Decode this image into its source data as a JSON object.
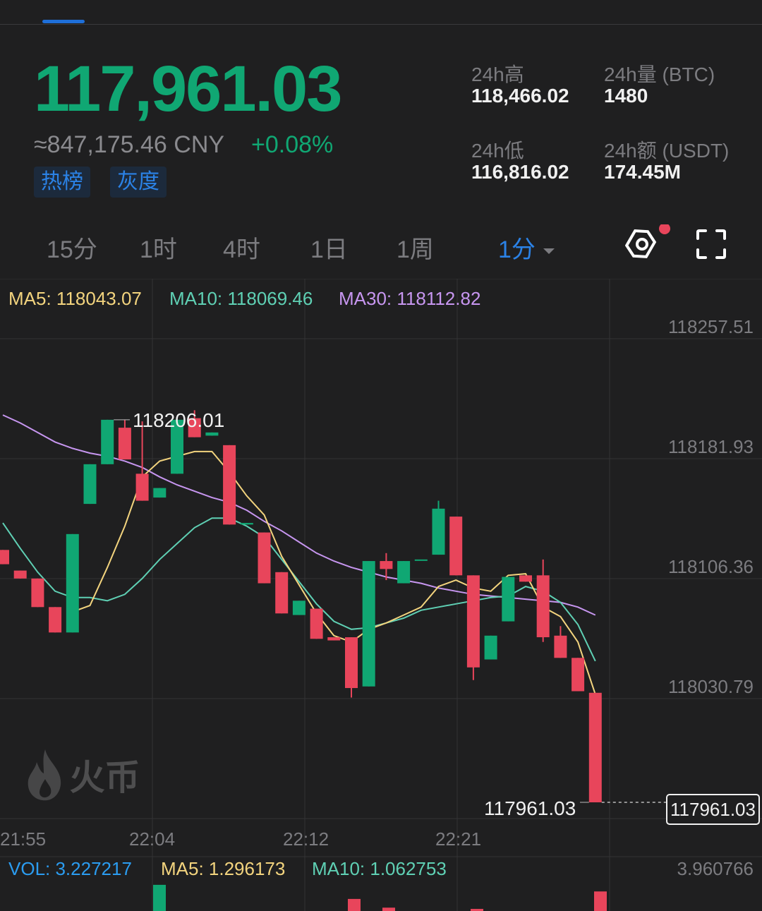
{
  "header": {
    "price": "117,961.03",
    "cny": "≈847,175.46 CNY",
    "change": "+0.08%",
    "tags": [
      "热榜",
      "灰度"
    ]
  },
  "stats": {
    "high_label": "24h高",
    "high_value": "118,466.02",
    "volume_label": "24h量 (BTC)",
    "volume_value": "1480",
    "low_label": "24h低",
    "low_value": "116,816.02",
    "turnover_label": "24h额 (USDT)",
    "turnover_value": "174.45M"
  },
  "timeframes": [
    "15分",
    "1时",
    "4时",
    "1日",
    "1周"
  ],
  "active_timeframe": "1分",
  "ma_legend": {
    "ma5": "MA5: 118043.07",
    "ma10": "MA10: 118069.46",
    "ma30": "MA30: 118112.82"
  },
  "watermark": "火币",
  "vol_legend": {
    "vol": "VOL: 3.227217",
    "ma5": "MA5: 1.296173",
    "ma10": "MA10: 1.062753",
    "max": "3.960766"
  },
  "colors": {
    "up": "#10a773",
    "down": "#e8455b",
    "ma5": "#f3d47e",
    "ma10": "#5fd0b4",
    "ma30": "#c796f0",
    "accent": "#2b82e6"
  },
  "chart_data": {
    "type": "candlestick",
    "y_ticks": [
      "118257.51",
      "118181.93",
      "118106.36",
      "118030.79"
    ],
    "y_tick_values": [
      118257.51,
      118181.93,
      118106.36,
      118030.79
    ],
    "x_ticks": [
      "21:55",
      "22:04",
      "22:12",
      "22:21"
    ],
    "max_label": "118206.01",
    "last_price_label": "117961.03",
    "last_price_tag": "117961.03",
    "candles": [
      {
        "o": 118116,
        "c": 118107,
        "h": 118116,
        "l": 118107
      },
      {
        "o": 118103,
        "c": 118098,
        "h": 118103,
        "l": 118098
      },
      {
        "o": 118098,
        "c": 118080,
        "h": 118098,
        "l": 118080
      },
      {
        "o": 118080,
        "c": 118064,
        "h": 118080,
        "l": 118064
      },
      {
        "o": 118064,
        "c": 118126,
        "h": 118126,
        "l": 118064
      },
      {
        "o": 118145,
        "c": 118170,
        "h": 118170,
        "l": 118145
      },
      {
        "o": 118170,
        "c": 118198,
        "h": 118198,
        "l": 118170
      },
      {
        "o": 118193,
        "c": 118173,
        "h": 118198,
        "l": 118173
      },
      {
        "o": 118164,
        "c": 118147,
        "h": 118197,
        "l": 118147
      },
      {
        "o": 118149,
        "c": 118155,
        "h": 118155,
        "l": 118149
      },
      {
        "o": 118164,
        "c": 118198,
        "h": 118198,
        "l": 118164
      },
      {
        "o": 118199,
        "c": 118187,
        "h": 118204,
        "l": 118187
      },
      {
        "o": 118188,
        "c": 118190,
        "h": 118190,
        "l": 118188
      },
      {
        "o": 118182,
        "c": 118132,
        "h": 118182,
        "l": 118132
      },
      {
        "o": 118132,
        "c": 118133,
        "h": 118133,
        "l": 118132
      },
      {
        "o": 118127,
        "c": 118095,
        "h": 118127,
        "l": 118095
      },
      {
        "o": 118102,
        "c": 118076,
        "h": 118102,
        "l": 118076
      },
      {
        "o": 118075,
        "c": 118084,
        "h": 118084,
        "l": 118075
      },
      {
        "o": 118079,
        "c": 118060,
        "h": 118079,
        "l": 118060
      },
      {
        "o": 118061,
        "c": 118059,
        "h": 118061,
        "l": 118059
      },
      {
        "o": 118061,
        "c": 118029,
        "h": 118061,
        "l": 118023
      },
      {
        "o": 118030,
        "c": 118109,
        "h": 118109,
        "l": 118030
      },
      {
        "o": 118109,
        "c": 118104,
        "h": 118114,
        "l": 118097
      },
      {
        "o": 118095,
        "c": 118109,
        "h": 118109,
        "l": 118095
      },
      {
        "o": 118110,
        "c": 118110,
        "h": 118110,
        "l": 118110
      },
      {
        "o": 118113,
        "c": 118142,
        "h": 118147,
        "l": 118113
      },
      {
        "o": 118137,
        "c": 118100,
        "h": 118137,
        "l": 118100
      },
      {
        "o": 118100,
        "c": 118042,
        "h": 118100,
        "l": 118034
      },
      {
        "o": 118047,
        "c": 118062,
        "h": 118062,
        "l": 118047
      },
      {
        "o": 118071,
        "c": 118099,
        "h": 118099,
        "l": 118071
      },
      {
        "o": 118100,
        "c": 118096,
        "h": 118100,
        "l": 118096
      },
      {
        "o": 118100,
        "c": 118061,
        "h": 118110,
        "l": 118058
      },
      {
        "o": 118062,
        "c": 118048,
        "h": 118068,
        "l": 118048
      },
      {
        "o": 118048,
        "c": 118027,
        "h": 118048,
        "l": 118027
      },
      {
        "o": 118026,
        "c": 117957,
        "h": 118026,
        "l": 117957
      }
    ],
    "ma5": [
      null,
      null,
      null,
      null,
      118077,
      118081,
      118105,
      118131,
      118162,
      118172,
      118175,
      118178,
      118178,
      118165,
      118150,
      118138,
      118112,
      118094,
      118076,
      118062,
      118058,
      118066,
      118070,
      118075,
      118080,
      118093,
      118097,
      118092,
      118090,
      118100,
      118101,
      118080,
      118074,
      118058,
      118025
    ],
    "ma10": [
      118133,
      118117,
      118102,
      118090,
      118086,
      118086,
      118084,
      118088,
      118098,
      118110,
      118120,
      118130,
      118136,
      118136,
      118131,
      118124,
      118110,
      118096,
      118082,
      118071,
      118066,
      118067,
      118070,
      118073,
      118078,
      118080,
      118082,
      118084,
      118086,
      118087,
      118093,
      118090,
      118083,
      118069,
      118046
    ],
    "ma30": [
      118201,
      118196,
      118190,
      118184,
      118180,
      118177,
      118175,
      118172,
      118168,
      118162,
      118157,
      118153,
      118149,
      118146,
      118141,
      118134,
      118128,
      118121,
      118114,
      118109,
      118105,
      118102,
      118099,
      118097,
      118095,
      118092,
      118090,
      118088,
      118087,
      118086,
      118085,
      118084,
      118083,
      118080,
      118075
    ],
    "volume_bars": [
      {
        "dir": "up",
        "value": 3.23
      },
      {
        "dir": "down",
        "value": 2.1
      },
      {
        "dir": "down",
        "value": 1.4
      },
      {
        "dir": "down",
        "value": 1.3
      },
      {
        "dir": "down",
        "value": 2.7
      }
    ]
  }
}
